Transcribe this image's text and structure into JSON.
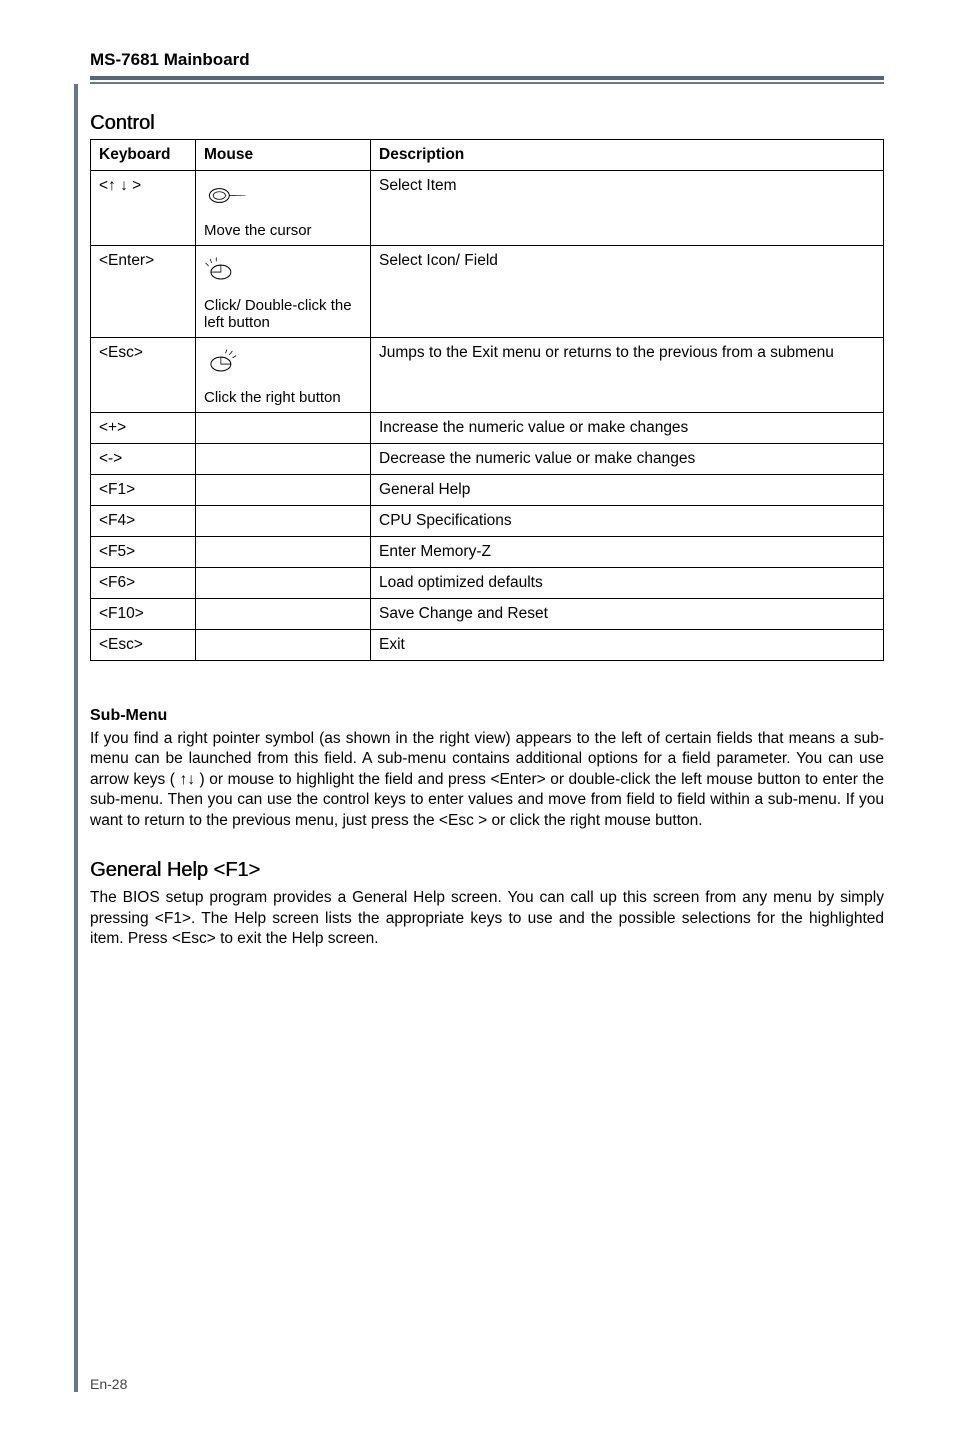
{
  "header": {
    "product": "MS-7681 Mainboard"
  },
  "control": {
    "title": "Control",
    "columns": {
      "kb": "Keyboard",
      "mouse": "Mouse",
      "desc": "Description"
    },
    "rows": [
      {
        "kb": "<↑ ↓ >",
        "mouse": "Move the cursor",
        "desc": "Select Item",
        "icon": "move"
      },
      {
        "kb": "<Enter>",
        "mouse": "Click/ Double-click the left button",
        "desc": "Select  Icon/ Field",
        "icon": "click"
      },
      {
        "kb": "<Esc>",
        "mouse": "Click the right button",
        "desc": "Jumps to the Exit menu or returns to the previous from a submenu",
        "icon": "rclick"
      },
      {
        "kb": "<+>",
        "mouse": "",
        "desc": "Increase the numeric value or make changes",
        "icon": ""
      },
      {
        "kb": "<->",
        "mouse": "",
        "desc": "Decrease the numeric value or make changes",
        "icon": ""
      },
      {
        "kb": "<F1>",
        "mouse": "",
        "desc": "General Help",
        "icon": ""
      },
      {
        "kb": "<F4>",
        "mouse": "",
        "desc": "CPU Specifications",
        "icon": ""
      },
      {
        "kb": "<F5>",
        "mouse": "",
        "desc": "Enter Memory-Z",
        "icon": ""
      },
      {
        "kb": "<F6>",
        "mouse": "",
        "desc": "Load optimized defaults",
        "icon": ""
      },
      {
        "kb": "<F10>",
        "mouse": "",
        "desc": "Save Change and Reset",
        "icon": ""
      },
      {
        "kb": "<Esc>",
        "mouse": "",
        "desc": "Exit",
        "icon": ""
      }
    ]
  },
  "submenu": {
    "title": "Sub-Menu",
    "body": "If you find a right pointer symbol (as shown in the right  view) appears to the left of certain fields that means a sub-menu can be launched from this field. A sub-menu contains additional options for a field parameter. You can use arrow keys  ( ↑↓ )  or mouse to highlight the field and press <Enter> or double-click the left mouse button to enter the sub-menu. Then you can use the control keys to enter values and  move from field to field within a sub-menu. If you want to return to the previous menu, just press the <Esc > or click the right mouse button."
  },
  "generalHelp": {
    "title": "General Help <F1>",
    "body": "The BIOS setup program provides a General  Help screen. You can call up this screen from any menu by simply pressing <F1>. The Help screen lists the appropriate keys to use and the possible selections for the highlighted item. Press <Esc> to exit the Help screen."
  },
  "footer": {
    "page": "En-28"
  }
}
